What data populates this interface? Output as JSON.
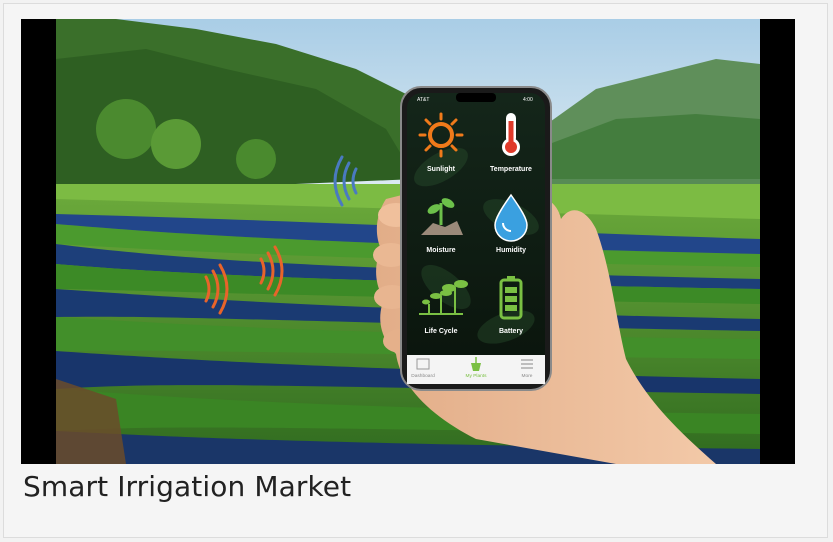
{
  "caption": "Smart Irrigation Market",
  "phone": {
    "status_carrier": "AT&T",
    "status_right": "4:00",
    "tiles": [
      {
        "label": "Sunlight",
        "icon": "sun-icon"
      },
      {
        "label": "Temperature",
        "icon": "thermometer-icon"
      },
      {
        "label": "Moisture",
        "icon": "sprout-soil-icon"
      },
      {
        "label": "Humidity",
        "icon": "water-drop-icon"
      },
      {
        "label": "Life Cycle",
        "icon": "plants-growth-icon"
      },
      {
        "label": "Battery",
        "icon": "battery-icon"
      }
    ],
    "tabs": [
      {
        "label": "Dashboard",
        "icon": "dashboard-icon"
      },
      {
        "label": "My Plants",
        "icon": "plant-pot-icon"
      },
      {
        "label": "More",
        "icon": "list-icon"
      }
    ]
  },
  "colors": {
    "sky": "#c9e0ef",
    "foliage": "#3f8a2a",
    "phone_bg": "#0d1a10",
    "accent_orange": "#f07a1a",
    "accent_blue": "#3aa0e0",
    "accent_green": "#7ac043",
    "signal_orange": "#e8642a",
    "signal_blue": "#4a7ac0"
  }
}
